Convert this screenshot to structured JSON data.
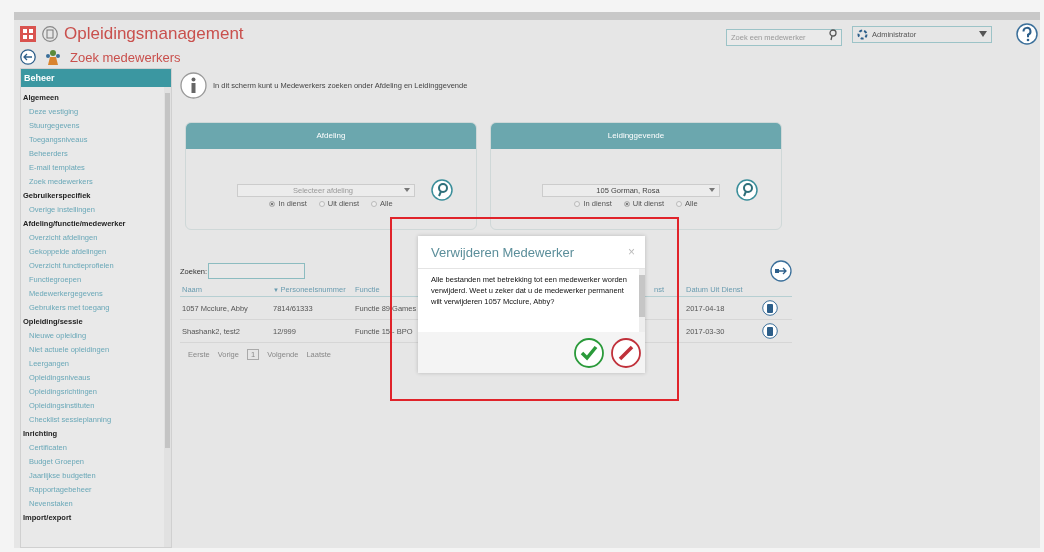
{
  "window": {
    "title": "Opleidingsmanagement"
  },
  "top_search": {
    "placeholder": "Zoek een medewerker"
  },
  "role_select": {
    "value": "Administrator"
  },
  "page": {
    "title": "Zoek medewerkers"
  },
  "sidebar": {
    "title": "Beheer",
    "groups": [
      {
        "label": "Algemeen",
        "items": [
          {
            "label": "Deze vestiging"
          },
          {
            "label": "Stuurgegevens"
          },
          {
            "label": "Toegangsniveaus"
          },
          {
            "label": "Beheerders"
          },
          {
            "label": "E-mail templates"
          },
          {
            "label": "Zoek medewerkers"
          }
        ]
      },
      {
        "label": "Gebruikerspecifiek",
        "items": [
          {
            "label": "Overige instellingen"
          }
        ]
      },
      {
        "label": "Afdeling/functie/medewerker",
        "items": [
          {
            "label": "Overzicht afdelingen"
          },
          {
            "label": "Gekoppelde afdelingen"
          },
          {
            "label": "Overzicht functieprofielen"
          },
          {
            "label": "Functiegroepen"
          },
          {
            "label": "Medewerkergegevens"
          },
          {
            "label": "Gebruikers met toegang"
          }
        ]
      },
      {
        "label": "Opleiding/sessie",
        "items": [
          {
            "label": "Nieuwe opleiding"
          },
          {
            "label": "Niet actuele opleidingen"
          },
          {
            "label": "Leergangen"
          },
          {
            "label": "Opleidingsniveaus"
          },
          {
            "label": "Opleidingsrichtingen"
          },
          {
            "label": "Opleidingsinstituten"
          },
          {
            "label": "Checklist sessieplanning"
          }
        ]
      },
      {
        "label": "Inrichting",
        "items": [
          {
            "label": "Certificaten"
          },
          {
            "label": "Budget Groepen"
          },
          {
            "label": "Jaarlijkse budgetten"
          },
          {
            "label": "Rapportagebeheer"
          },
          {
            "label": "Nevenstaken"
          }
        ]
      },
      {
        "label": "Import/export"
      }
    ]
  },
  "info_text": "In dit scherm kunt u Medewerkers zoeken onder Afdeling en Leidinggevende",
  "filters": [
    {
      "title": "Afdeling",
      "select": {
        "placeholder": "Selecteer afdeling"
      },
      "radios": [
        {
          "label": "In dienst",
          "selected": true
        },
        {
          "label": "Uit dienst",
          "selected": false
        },
        {
          "label": "Alle",
          "selected": false
        }
      ]
    },
    {
      "title": "Leidinggevende",
      "select": {
        "value": "105 Gorman, Rosa"
      },
      "radios": [
        {
          "label": "In dienst",
          "selected": false
        },
        {
          "label": "Uit dienst",
          "selected": true
        },
        {
          "label": "Alle",
          "selected": false
        }
      ]
    }
  ],
  "search": {
    "label": "Zoeken:"
  },
  "table": {
    "columns": [
      {
        "kind": "text",
        "label": "Naam"
      },
      {
        "kind": "text",
        "label": "Personeelsnummer",
        "sort_mark": "▼"
      },
      {
        "kind": "text",
        "label": "Functie"
      },
      {
        "kind": "covered",
        "label": "nst"
      },
      {
        "kind": "text",
        "label": "Datum Uit Dienst"
      }
    ],
    "rows": [
      {
        "cells": [
          "1057 Mcclure, Abby",
          "7814/61333",
          "Functie 89 Games",
          "2017-04-18"
        ]
      },
      {
        "cells": [
          "Shashank2, test2",
          "12/999",
          "Functie 15 - BPO",
          "2017-03-30"
        ]
      }
    ]
  },
  "pager": {
    "first": "Eerste",
    "previous": "Vorige",
    "page": "1",
    "next": "Volgende",
    "last": "Laatste"
  },
  "dialog": {
    "title": "Verwijderen Medewerker",
    "close": "×",
    "message": "Alle bestanden met betrekking tot een medewerker worden verwijderd. Weet u zeker dat u de medewerker permanent wilt verwijderen 1057 Mcclure, Abby?",
    "highlighted": true
  }
}
